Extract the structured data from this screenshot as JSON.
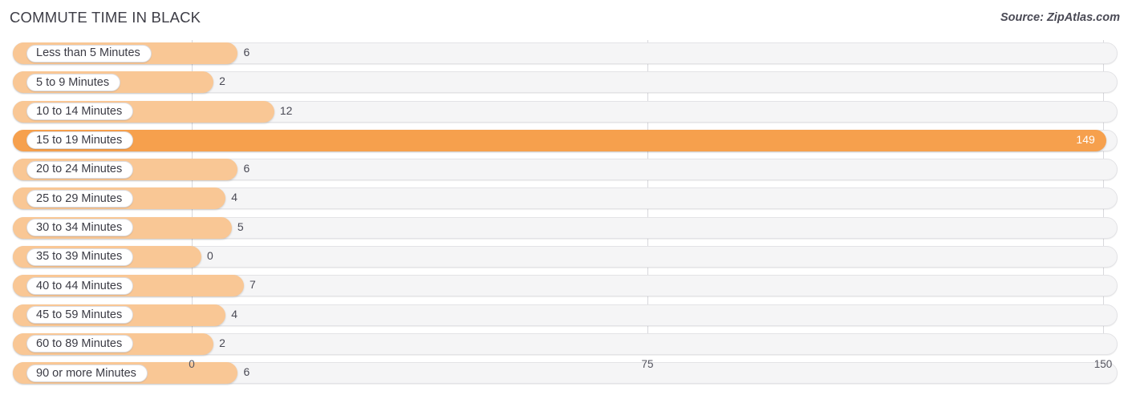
{
  "header": {
    "title": "COMMUTE TIME IN BLACK",
    "source": "Source: ZipAtlas.com"
  },
  "chart_data": {
    "type": "bar",
    "orientation": "horizontal",
    "title": "COMMUTE TIME IN BLACK",
    "source": "Source: ZipAtlas.com",
    "xlabel": "",
    "ylabel": "",
    "xlim": [
      0,
      150
    ],
    "xticks": [
      0,
      75,
      150
    ],
    "xtick_labels": [
      "0",
      "75",
      "150"
    ],
    "grid": true,
    "legend": false,
    "accent_color": "#f6a04d",
    "bar_color": "#f9c795",
    "track_color": "#f5f5f6",
    "categories": [
      "Less than 5 Minutes",
      "5 to 9 Minutes",
      "10 to 14 Minutes",
      "15 to 19 Minutes",
      "20 to 24 Minutes",
      "25 to 29 Minutes",
      "30 to 34 Minutes",
      "35 to 39 Minutes",
      "40 to 44 Minutes",
      "45 to 59 Minutes",
      "60 to 89 Minutes",
      "90 or more Minutes"
    ],
    "values": [
      6,
      2,
      12,
      149,
      6,
      4,
      5,
      0,
      7,
      4,
      2,
      6
    ],
    "value_labels": [
      "6",
      "2",
      "12",
      "149",
      "6",
      "4",
      "5",
      "0",
      "7",
      "4",
      "2",
      "6"
    ],
    "highlight_index": 3
  },
  "rows": [
    {
      "label": "Less than 5 Minutes",
      "value": 6,
      "value_label": "6",
      "highlight": false
    },
    {
      "label": "5 to 9 Minutes",
      "value": 2,
      "value_label": "2",
      "highlight": false
    },
    {
      "label": "10 to 14 Minutes",
      "value": 12,
      "value_label": "12",
      "highlight": false
    },
    {
      "label": "15 to 19 Minutes",
      "value": 149,
      "value_label": "149",
      "highlight": true
    },
    {
      "label": "20 to 24 Minutes",
      "value": 6,
      "value_label": "6",
      "highlight": false
    },
    {
      "label": "25 to 29 Minutes",
      "value": 4,
      "value_label": "4",
      "highlight": false
    },
    {
      "label": "30 to 34 Minutes",
      "value": 5,
      "value_label": "5",
      "highlight": false
    },
    {
      "label": "35 to 39 Minutes",
      "value": 0,
      "value_label": "0",
      "highlight": false
    },
    {
      "label": "40 to 44 Minutes",
      "value": 7,
      "value_label": "7",
      "highlight": false
    },
    {
      "label": "45 to 59 Minutes",
      "value": 4,
      "value_label": "4",
      "highlight": false
    },
    {
      "label": "60 to 89 Minutes",
      "value": 2,
      "value_label": "2",
      "highlight": false
    },
    {
      "label": "90 or more Minutes",
      "value": 6,
      "value_label": "6",
      "highlight": false
    }
  ],
  "axis": {
    "ticks": [
      {
        "label": "0",
        "value": 0
      },
      {
        "label": "75",
        "value": 75
      },
      {
        "label": "150",
        "value": 150
      }
    ]
  }
}
